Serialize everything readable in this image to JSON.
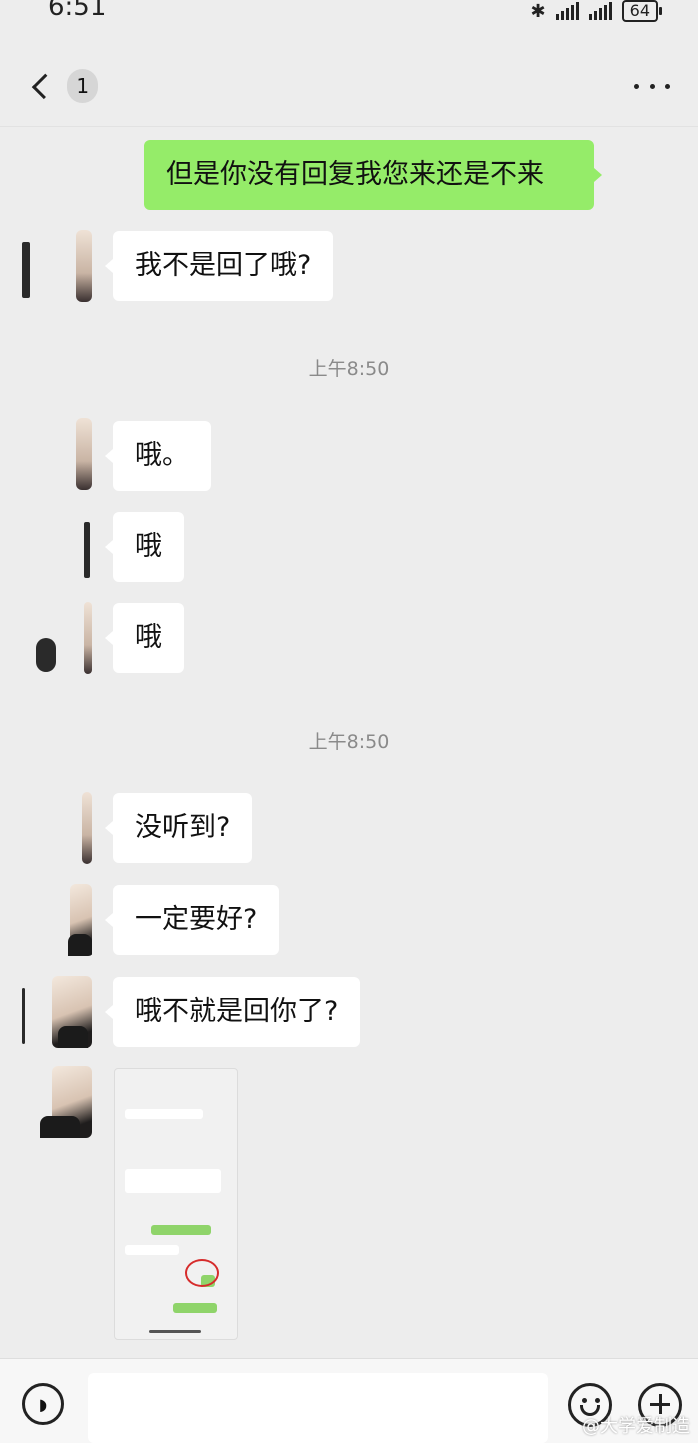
{
  "status_bar": {
    "time": "6:51",
    "battery": "64",
    "icons": [
      "bluetooth-icon",
      "signal-icon",
      "signal-icon",
      "battery-icon"
    ]
  },
  "nav": {
    "unread_count": "1",
    "back_icon": "chevron-left-icon",
    "more_icon": "more-dots-icon"
  },
  "colors": {
    "background": "#ededed",
    "incoming_bubble": "#ffffff",
    "outgoing_bubble": "#95ec69"
  },
  "messages": [
    {
      "from": "me",
      "text": "但是你没有回复我您来还是不来"
    },
    {
      "from": "other",
      "text": "我不是回了哦?"
    },
    {
      "from": "other",
      "text": "哦。"
    },
    {
      "from": "other",
      "text": "哦"
    },
    {
      "from": "other",
      "text": "哦"
    },
    {
      "from": "other",
      "text": "没听到?"
    },
    {
      "from": "other",
      "text": "一定要好?"
    },
    {
      "from": "other",
      "text": "哦不就是回你了?"
    },
    {
      "from": "other",
      "type": "image",
      "text": ""
    }
  ],
  "timestamps": [
    "上午8:50",
    "上午8:50"
  ],
  "input_bar": {
    "voice_icon": "voice-icon",
    "emoji_icon": "emoji-icon",
    "plus_icon": "plus-icon",
    "input_value": ""
  },
  "watermark": "@大学爱制造"
}
